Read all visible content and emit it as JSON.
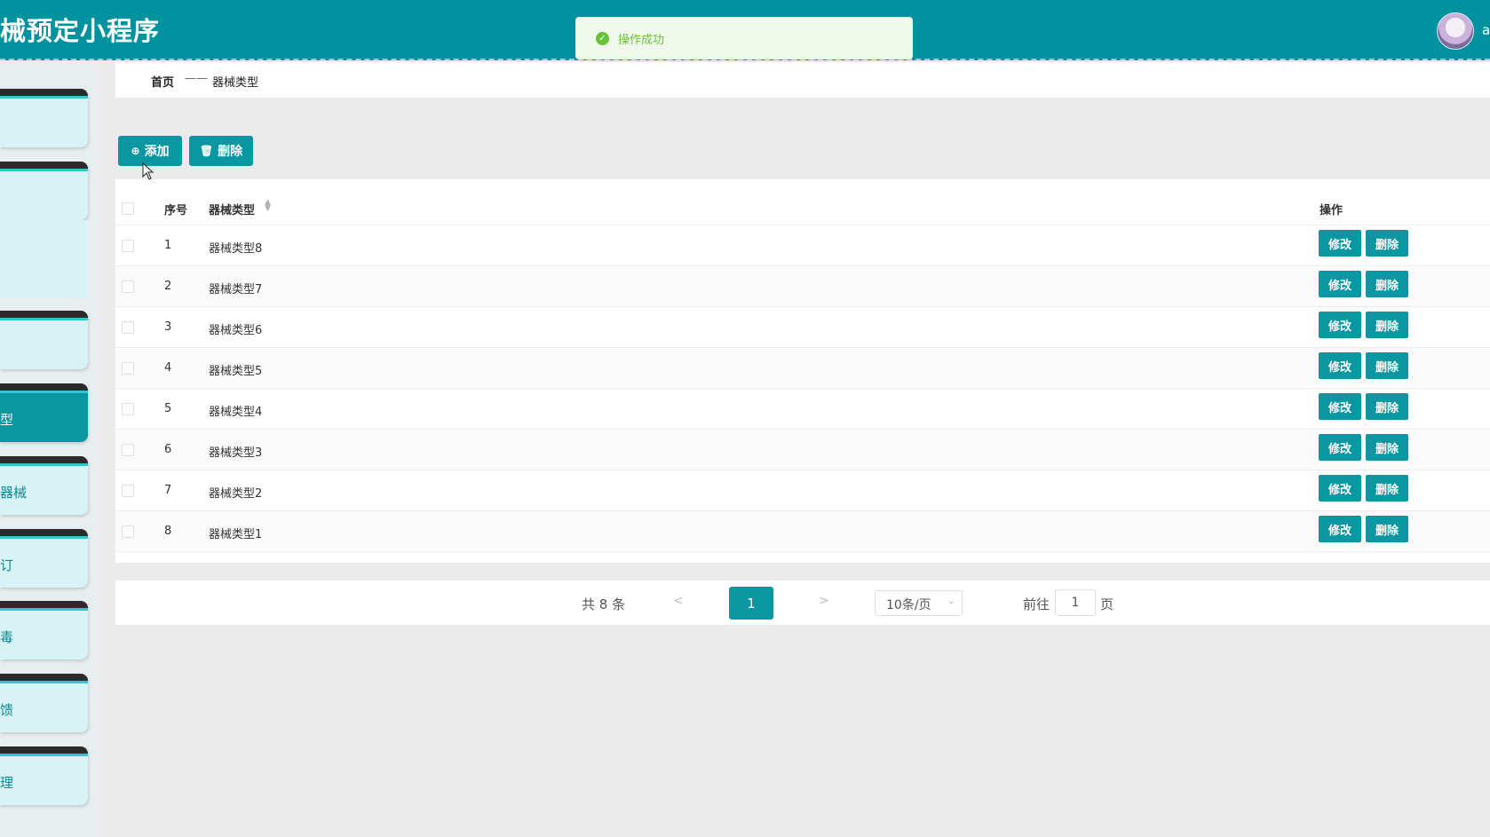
{
  "header": {
    "title": "械预定小程序",
    "user_initial": "a"
  },
  "toast": {
    "message": "操作成功"
  },
  "sidebar": {
    "items": [
      {
        "label": ""
      },
      {
        "label": "\u0001"
      },
      {
        "label": ""
      },
      {
        "label": "型"
      },
      {
        "label": "器械"
      },
      {
        "label": "订"
      },
      {
        "label": "毒"
      },
      {
        "label": "馈"
      },
      {
        "label": "理"
      }
    ]
  },
  "breadcrumb": {
    "home": "首页",
    "separator": "——",
    "current": "器械类型"
  },
  "toolbar": {
    "add_label": "添加",
    "delete_label": "删除"
  },
  "table": {
    "columns": {
      "index": "序号",
      "type": "器械类型",
      "actions": "操作"
    },
    "rows": [
      {
        "index": "1",
        "type": "器械类型8"
      },
      {
        "index": "2",
        "type": "器械类型7"
      },
      {
        "index": "3",
        "type": "器械类型6"
      },
      {
        "index": "4",
        "type": "器械类型5"
      },
      {
        "index": "5",
        "type": "器械类型4"
      },
      {
        "index": "6",
        "type": "器械类型3"
      },
      {
        "index": "7",
        "type": "器械类型2"
      },
      {
        "index": "8",
        "type": "器械类型1"
      }
    ],
    "edit_label": "修改",
    "delete_label": "删除"
  },
  "pagination": {
    "total": "共 8 条",
    "prev": "<",
    "current_page": "1",
    "next": ">",
    "page_size": "10条/页",
    "goto_label": "前往",
    "goto_value": "1",
    "page_word": "页"
  },
  "colors": {
    "primary": "#0a97a2",
    "success": "#67c23a"
  },
  "icons": {
    "add": "plus-circle-icon",
    "delete": "trash-icon",
    "success": "check-circle-icon",
    "sort": "sort-caret-icon"
  }
}
